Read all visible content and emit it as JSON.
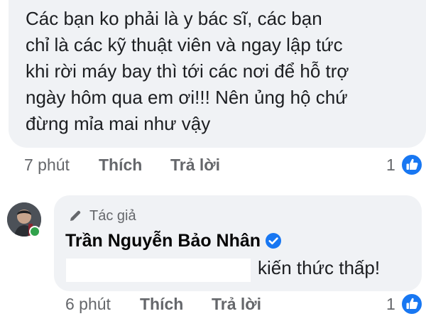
{
  "comment1": {
    "text": "Các bạn ko phải là y bác sĩ, các bạn\nchỉ là các kỹ thuật viên và ngay lập tức\nkhi rời máy bay thì tới các nơi để hỗ trợ\nngày hôm qua em ơi!!! Nên ủng hộ chứ\nđừng mỉa mai như vậy",
    "time": "7 phút",
    "like_label": "Thích",
    "reply_label": "Trả lời",
    "like_count": "1"
  },
  "comment2": {
    "badge": "Tác giả",
    "author": "Trần Nguyễn Bảo Nhân",
    "text": "kiến thức thấp!",
    "time": "6 phút",
    "like_label": "Thích",
    "reply_label": "Trả lời",
    "like_count": "1"
  },
  "icons": {
    "like": "thumbs-up-icon",
    "verified": "verified-badge-icon",
    "author": "pen-icon"
  },
  "colors": {
    "bubble": "#f0f2f5",
    "muted": "#65676b",
    "like_blue": "#1877f2",
    "online": "#31a24c"
  }
}
